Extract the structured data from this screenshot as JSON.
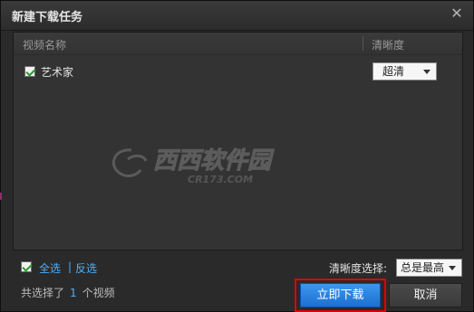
{
  "dialog": {
    "title": "新建下载任务",
    "close_glyph": "✕"
  },
  "table": {
    "columns": [
      "视频名称",
      "清晰度"
    ],
    "rows": [
      {
        "checked": true,
        "name": "艺术家",
        "quality": "超清"
      }
    ]
  },
  "watermark": {
    "brand": "西西软件园",
    "domain": "CR173.COM"
  },
  "footer": {
    "select_all": "全选",
    "separator": "|",
    "invert": "反选",
    "quality_label": "清晰度选择:",
    "quality_value": "总是最高",
    "selected_prefix": "共选择了",
    "selected_count": "1",
    "selected_suffix": "个视频"
  },
  "buttons": {
    "download_now": "立即下载",
    "cancel": "取消"
  },
  "colors": {
    "accent_blue": "#4ab0ff",
    "primary_button": "#1e6fd0",
    "highlight_frame": "#e00000",
    "dialog_bg": "#2a2a2a"
  }
}
